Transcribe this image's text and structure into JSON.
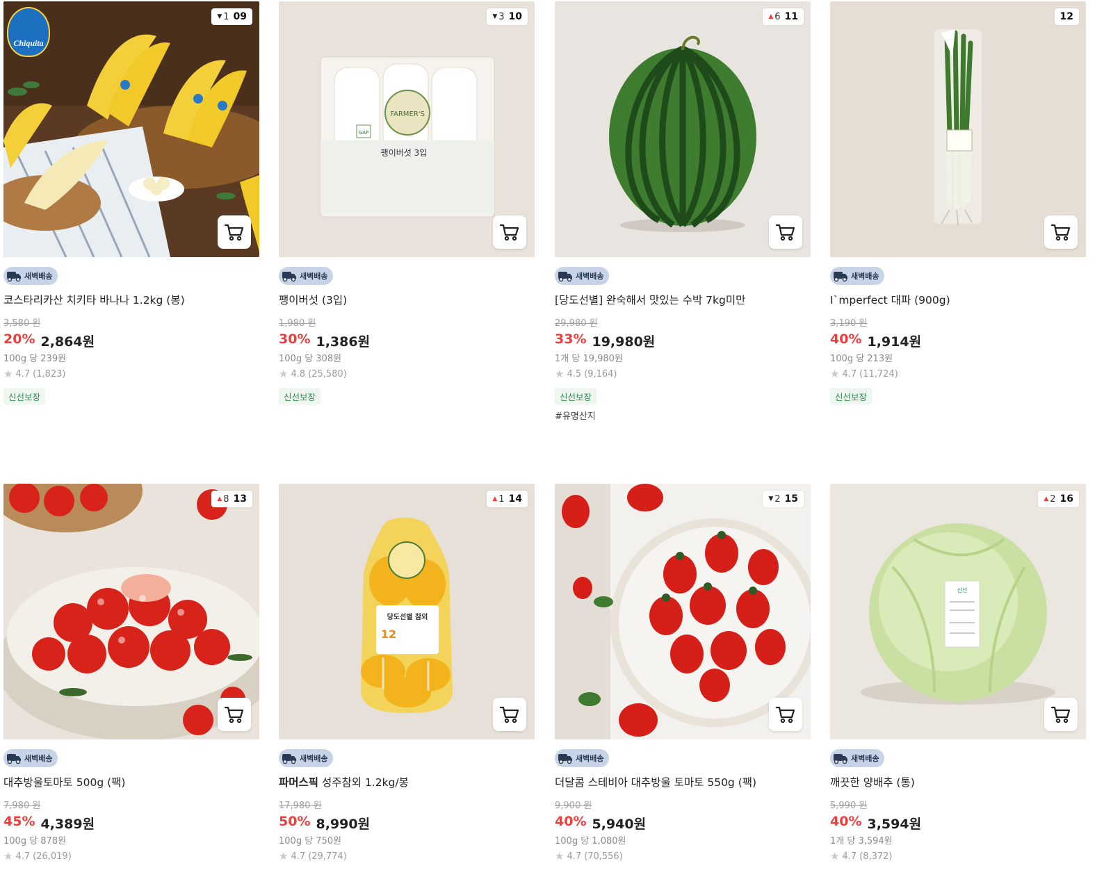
{
  "products": [
    {
      "name_prefix": "",
      "name": "코스타리카산 치키타 바나나 1.2kg (봉)",
      "badge": "새벽배송",
      "original_price": "3,580 원",
      "discount": "20%",
      "price": "2,864원",
      "unit_price": "100g 당 239원",
      "rating": "4.7",
      "reviews": "(1,823)",
      "fresh_label": "신선보장",
      "tag": "",
      "rank": "09",
      "rank_change": "1",
      "rank_dir": "down",
      "image": "bananas",
      "brand_logo": "Chiquita"
    },
    {
      "name_prefix": "",
      "name": "팽이버섯 (3입)",
      "badge": "새벽배송",
      "original_price": "1,980 원",
      "discount": "30%",
      "price": "1,386원",
      "unit_price": "100g 당 308원",
      "rating": "4.8",
      "reviews": "(25,580)",
      "fresh_label": "신선보장",
      "tag": "",
      "rank": "10",
      "rank_change": "3",
      "rank_dir": "down",
      "image": "enoki-mushrooms"
    },
    {
      "name_prefix": "",
      "name": "[당도선별] 완숙해서 맛있는 수박 7kg미만",
      "badge": "새벽배송",
      "original_price": "29,980 원",
      "discount": "33%",
      "price": "19,980원",
      "unit_price": "1개 당 19,980원",
      "rating": "4.5",
      "reviews": "(9,164)",
      "fresh_label": "신선보장",
      "tag": "#유명산지",
      "rank": "11",
      "rank_change": "6",
      "rank_dir": "up",
      "image": "watermelon"
    },
    {
      "name_prefix": "",
      "name": "I`mperfect 대파 (900g)",
      "badge": "새벽배송",
      "original_price": "3,190 원",
      "discount": "40%",
      "price": "1,914원",
      "unit_price": "100g 당 213원",
      "rating": "4.7",
      "reviews": "(11,724)",
      "fresh_label": "신선보장",
      "tag": "",
      "rank": "12",
      "rank_change": "",
      "rank_dir": "none",
      "image": "green-onion"
    },
    {
      "name_prefix": "",
      "name": "대추방울토마토 500g (팩)",
      "badge": "새벽배송",
      "original_price": "7,980 원",
      "discount": "45%",
      "price": "4,389원",
      "unit_price": "100g 당 878원",
      "rating": "4.7",
      "reviews": "(26,019)",
      "fresh_label": "",
      "tag": "",
      "rank": "13",
      "rank_change": "8",
      "rank_dir": "up",
      "image": "cherry-tomatoes-bowl"
    },
    {
      "name_prefix": "파머스픽",
      "name": " 성주참외 1.2kg/봉",
      "badge": "새벽배송",
      "original_price": "17,980 원",
      "discount": "50%",
      "price": "8,990원",
      "unit_price": "100g 당 750원",
      "rating": "4.7",
      "reviews": "(29,774)",
      "fresh_label": "",
      "tag": "",
      "rank": "14",
      "rank_change": "1",
      "rank_dir": "up",
      "image": "korean-melon-bag"
    },
    {
      "name_prefix": "",
      "name": "더달콤 스테비아 대추방울 토마토 550g (팩)",
      "badge": "새벽배송",
      "original_price": "9,900 원",
      "discount": "40%",
      "price": "5,940원",
      "unit_price": "100g 당 1,080원",
      "rating": "4.7",
      "reviews": "(70,556)",
      "fresh_label": "",
      "tag": "",
      "rank": "15",
      "rank_change": "2",
      "rank_dir": "down",
      "image": "stevia-tomatoes-bowl"
    },
    {
      "name_prefix": "",
      "name": "깨끗한 양배추 (통)",
      "badge": "새벽배송",
      "original_price": "5,990 원",
      "discount": "40%",
      "price": "3,594원",
      "unit_price": "1개 당 3,594원",
      "rating": "4.7",
      "reviews": "(8,372)",
      "fresh_label": "",
      "tag": "",
      "rank": "16",
      "rank_change": "2",
      "rank_dir": "up",
      "image": "cabbage"
    }
  ],
  "colors": {
    "discount": "#f03d3d",
    "fresh_text": "#2e8b57",
    "badge_bg": "#c7d3e6"
  }
}
